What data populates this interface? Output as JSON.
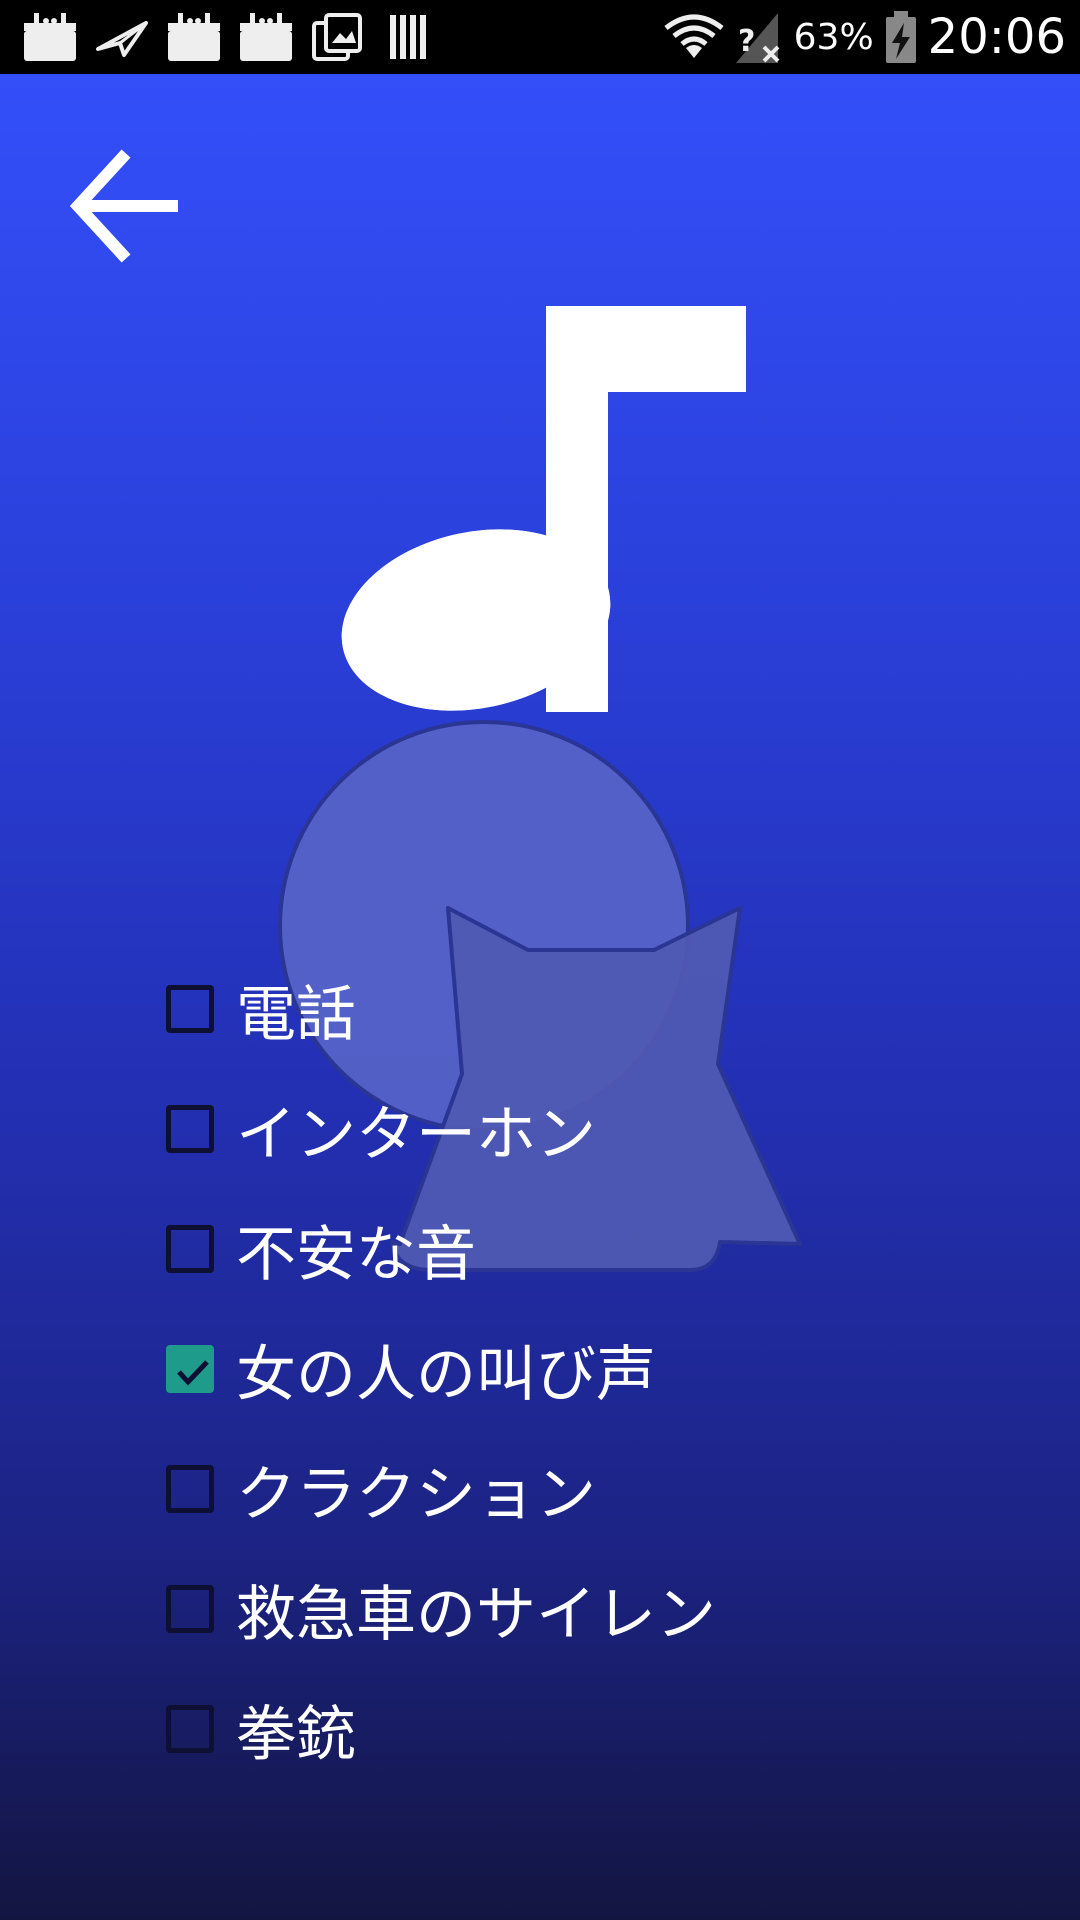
{
  "status_bar": {
    "left_icons": [
      "notification-box-icon",
      "paper-plane-icon",
      "notification-box-icon",
      "notification-box-icon",
      "photo-share-icon",
      "barcode-icon"
    ],
    "right_icons": [
      "wifi-icon",
      "no-signal-icon",
      "battery-charging-icon"
    ],
    "battery_percent": "63%",
    "time": "20:06"
  },
  "toolbar": {
    "back_icon": "arrow-left-icon"
  },
  "hero": {
    "note_icon": "music-note-icon",
    "mascot_icon": "cat-mascot-icon"
  },
  "colors": {
    "accent": "#1f9b8c",
    "background_top": "#334ff9",
    "background_bottom": "#131541"
  },
  "options": [
    {
      "label": "電話",
      "checked": false
    },
    {
      "label": "インターホン",
      "checked": false
    },
    {
      "label": "不安な音",
      "checked": false
    },
    {
      "label": "女の人の叫び声",
      "checked": true
    },
    {
      "label": "クラクション",
      "checked": false
    },
    {
      "label": "救急車のサイレン",
      "checked": false
    },
    {
      "label": "拳銃",
      "checked": false
    }
  ]
}
